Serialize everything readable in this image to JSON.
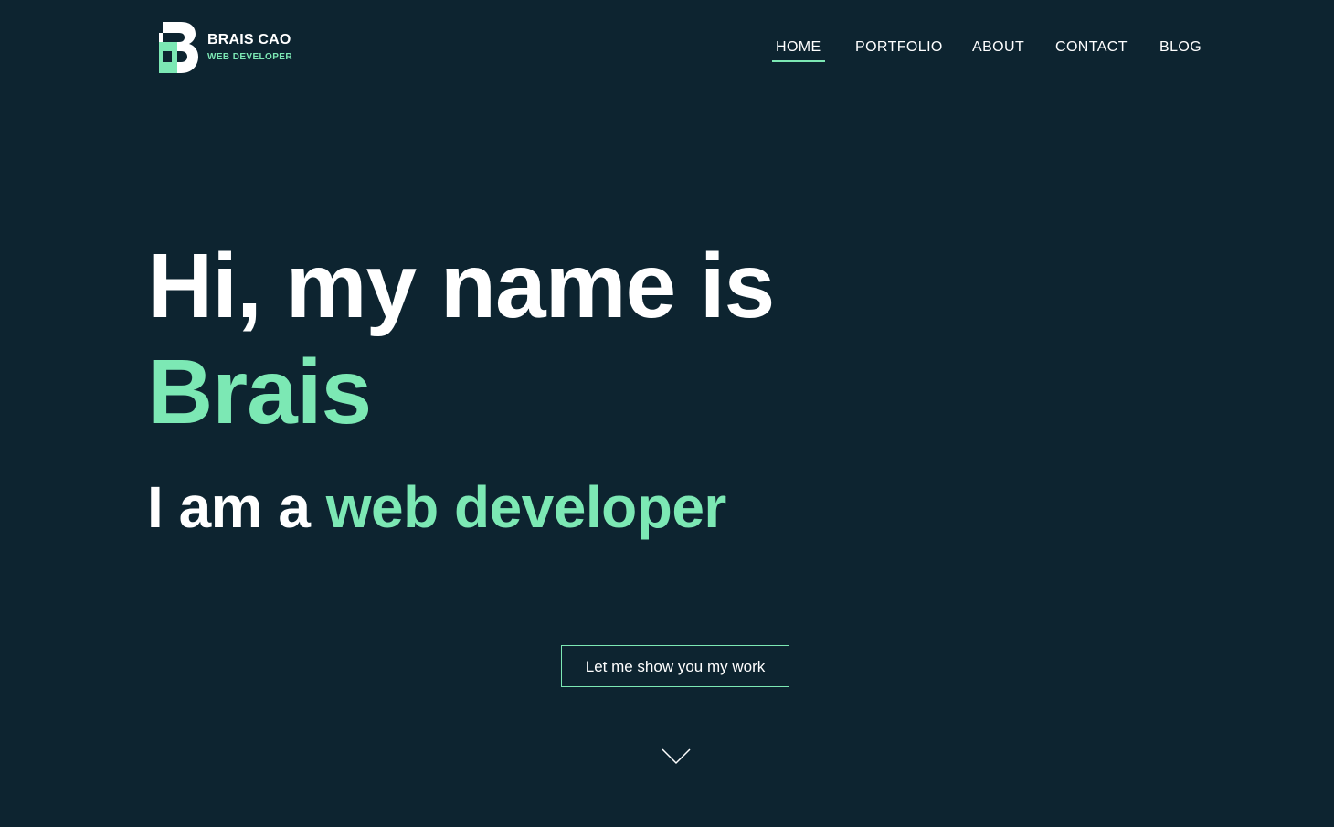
{
  "brand": {
    "name": "BRAIS CAO",
    "role": "WEB DEVELOPER",
    "logo_icon": "b-monogram-logo-icon"
  },
  "nav": {
    "items": [
      {
        "label": "HOME",
        "active": true
      },
      {
        "label": "PORTFOLIO",
        "active": false
      },
      {
        "label": "ABOUT",
        "active": false
      },
      {
        "label": "CONTACT",
        "active": false
      },
      {
        "label": "BLOG",
        "active": false
      }
    ]
  },
  "hero": {
    "greeting": "Hi, my name is",
    "name": "Brais",
    "intro_prefix": "I am a",
    "intro_role": "web developer"
  },
  "cta": {
    "label": "Let me show you my work"
  },
  "scroll": {
    "icon": "chevron-down-icon"
  },
  "colors": {
    "background": "#0d2430",
    "accent": "#7ce8b4",
    "text": "#ffffff"
  }
}
